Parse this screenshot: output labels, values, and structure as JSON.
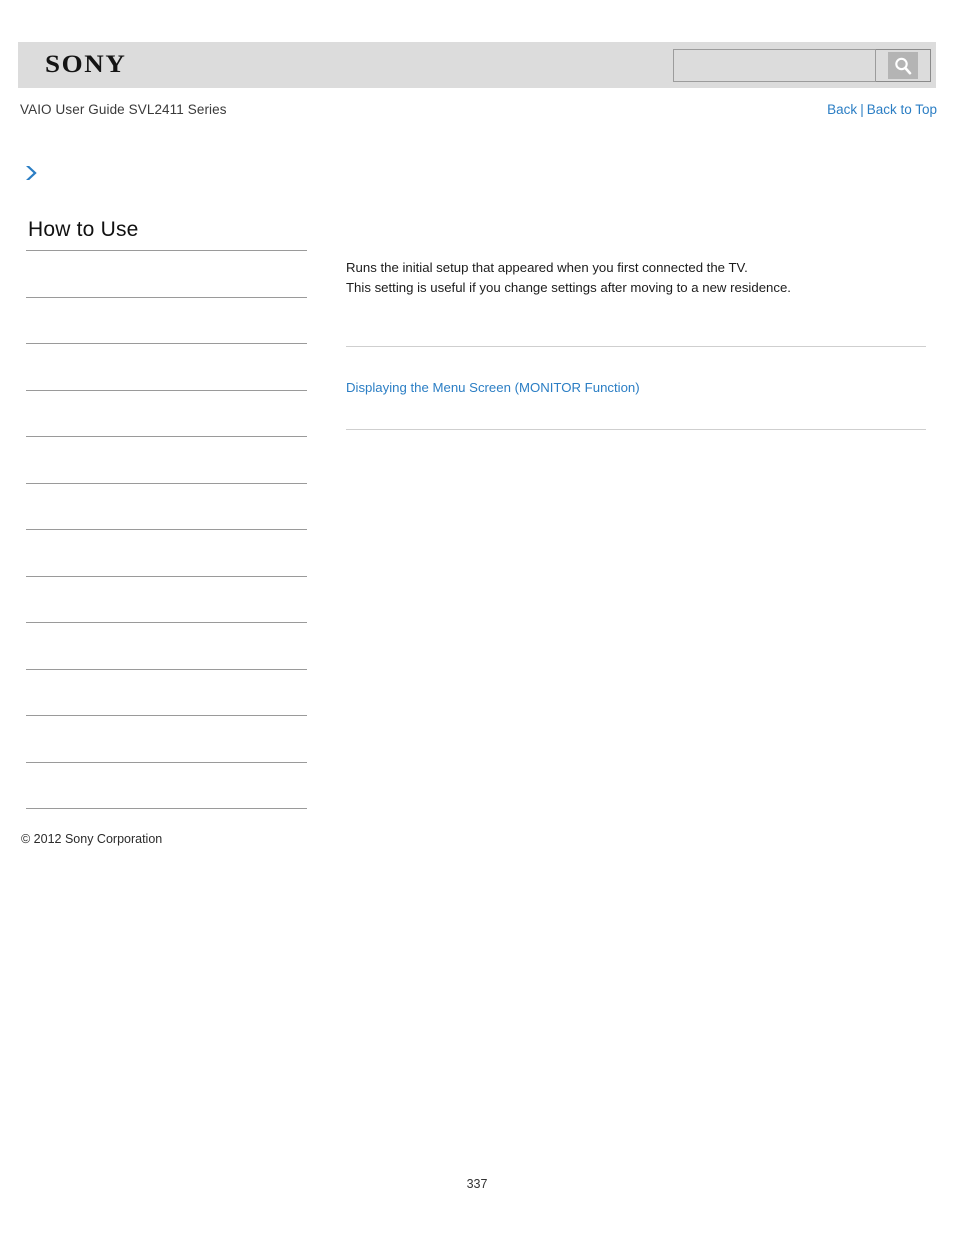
{
  "header": {
    "logo_text": "SONY",
    "search": {
      "value": "",
      "placeholder": "",
      "button_label": "",
      "icon": "search-icon"
    }
  },
  "subheader": {
    "guide_title": "VAIO User Guide SVL2411 Series",
    "back_label": "Back",
    "separator": "|",
    "back_to_top_label": "Back to Top"
  },
  "breadcrumb": {
    "icon": "chevron-right-icon",
    "text": ""
  },
  "sidebar": {
    "heading": "How to Use",
    "items": [
      {
        "label": ""
      },
      {
        "label": ""
      },
      {
        "label": ""
      },
      {
        "label": ""
      },
      {
        "label": ""
      },
      {
        "label": ""
      },
      {
        "label": ""
      },
      {
        "label": ""
      },
      {
        "label": ""
      },
      {
        "label": ""
      },
      {
        "label": ""
      },
      {
        "label": ""
      }
    ],
    "copyright": "© 2012 Sony Corporation"
  },
  "main": {
    "paragraph_line1": "Runs the initial setup that appeared when you first connected the TV.",
    "paragraph_line2": "This setting is useful if you change settings after moving to a new residence.",
    "related_link": "Displaying the Menu Screen (MONITOR Function)"
  },
  "footer": {
    "page_number": "337"
  },
  "colors": {
    "header_bg": "#dcdcdc",
    "link_blue": "#2b7ec4",
    "rule_gray": "#9a9a9a",
    "content_rule_gray": "#cfcfcf"
  }
}
